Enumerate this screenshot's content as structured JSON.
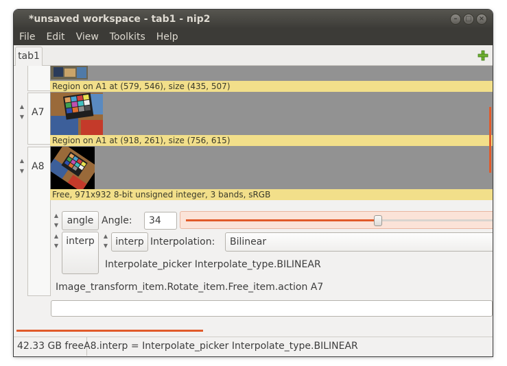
{
  "window": {
    "title": "*unsaved workspace - tab1 - nip2"
  },
  "menu": {
    "items": [
      "File",
      "Edit",
      "View",
      "Toolkits",
      "Help"
    ]
  },
  "tabs": {
    "active": "tab1"
  },
  "rows": {
    "a6": {
      "caption": "Region on A1 at (579, 546), size (435, 507)"
    },
    "a7": {
      "name": "A7",
      "caption": "Region on A1 at (918, 261), size (756, 615)"
    },
    "a8": {
      "name": "A8",
      "caption": "Free, 971x932 8-bit unsigned integer, 3 bands, sRGB",
      "angle": {
        "button": "angle",
        "label": "Angle:",
        "value": "34",
        "slider_fraction": 0.62
      },
      "interp": {
        "button": "interp",
        "inner_button": "interp",
        "label": "Interpolation:",
        "selected": "Bilinear",
        "desc": "Interpolate_picker Interpolate_type.BILINEAR"
      },
      "action": "Image_transform_item.Rotate_item.Free_item.action A7"
    }
  },
  "statusbar": {
    "free": "42.33 GB free",
    "message": "A8.interp = Interpolate_picker Interpolate_type.BILINEAR"
  },
  "colors": {
    "caption_bg": "#f2df8a",
    "accent": "#e05a2a",
    "titlebar": "#3c3b37",
    "image_bg": "#929292"
  },
  "icons": [
    "close-icon",
    "minimize-icon",
    "maximize-icon",
    "add-tab-icon",
    "dropdown-arrow-icon"
  ]
}
